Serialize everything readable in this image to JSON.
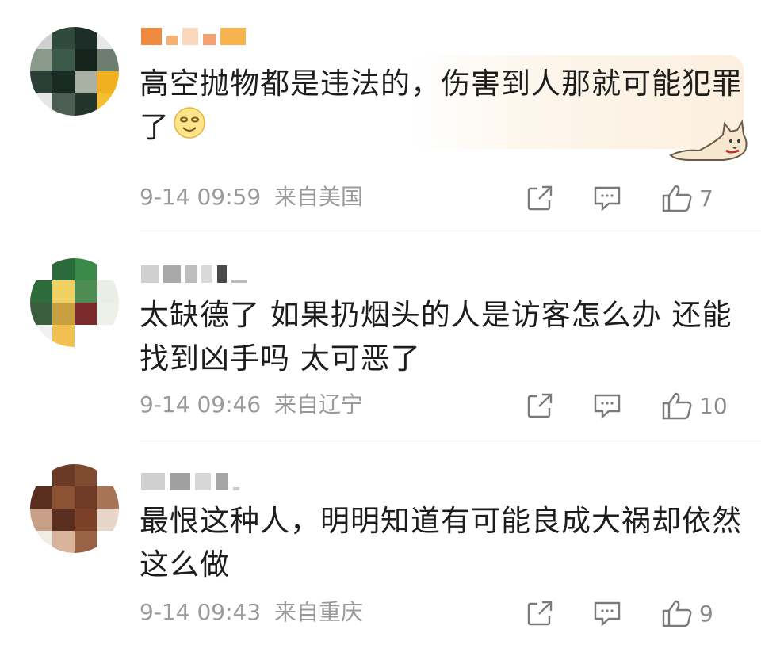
{
  "comments": [
    {
      "text": "高空抛物都是违法的，伤害到人那就可能犯罪了",
      "emoji": "😊",
      "time": "9-14 09:59",
      "location": "来自美国",
      "likes": "7"
    },
    {
      "text": "太缺德了 如果扔烟头的人是访客怎么办 还能找到凶手吗 太可恶了",
      "time": "9-14 09:46",
      "location": "来自辽宁",
      "likes": "10"
    },
    {
      "text": "最恨这种人，明明知道有可能良成大祸却依然这么做",
      "time": "9-14 09:43",
      "location": "来自重庆",
      "likes": "9"
    }
  ],
  "icons": {
    "share": "share-icon",
    "reply": "comment-icon",
    "like": "thumbs-up-icon"
  },
  "colors": {
    "text": "#1d1d1d",
    "meta": "#9a9a9a",
    "icon": "#7a7a7a",
    "highlight": "#fcefdf"
  }
}
